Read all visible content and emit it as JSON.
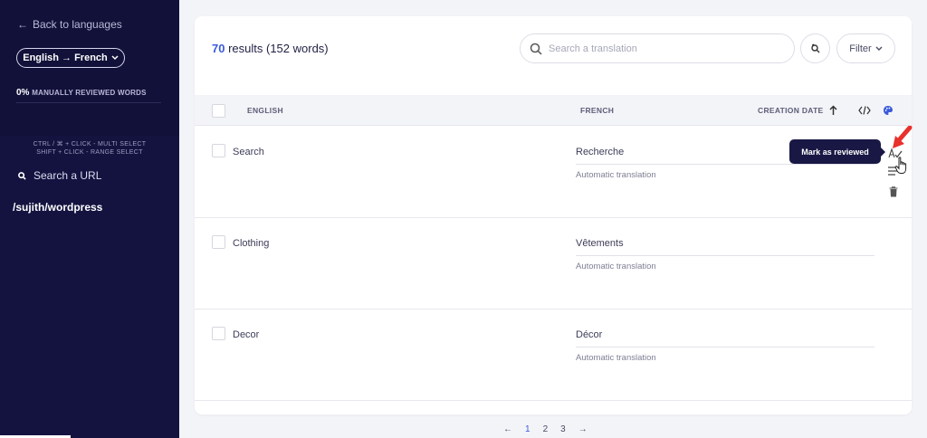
{
  "sidebar": {
    "back_label": "Back to languages",
    "language_pair": "English → French",
    "progress_percent": "0%",
    "progress_label": "MANUALLY REVIEWED WORDS",
    "progress_value": 0,
    "hint_multi": "CTRL / ⌘ + CLICK - MULTI SELECT",
    "hint_range": "SHIFT + CLICK - RANGE SELECT",
    "search_url": "Search a URL",
    "current_url": "/sujith/wordpress"
  },
  "header": {
    "results_count": "70",
    "results_text": "results (152 words)",
    "search_placeholder": "Search a translation",
    "filter_label": "Filter"
  },
  "table": {
    "columns": [
      "ENGLISH",
      "FRENCH",
      "CREATION DATE"
    ],
    "rows": [
      {
        "source": "Search",
        "target": "Recherche",
        "status": "Automatic translation"
      },
      {
        "source": "Clothing",
        "target": "Vêtements",
        "status": "Automatic translation"
      },
      {
        "source": "Decor",
        "target": "Décor",
        "status": "Automatic translation"
      }
    ]
  },
  "tooltip": {
    "text": "Mark as reviewed"
  },
  "pagination": {
    "prev": "←",
    "pages": [
      "1",
      "2",
      "3"
    ],
    "next": "→",
    "current": "1"
  },
  "colors": {
    "sidebar": "#141340",
    "accent": "#3b5bdb",
    "arrow": "#e8312c"
  }
}
